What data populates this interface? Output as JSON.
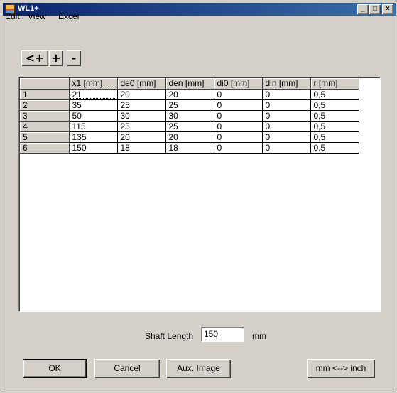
{
  "window": {
    "title": "WL1+"
  },
  "menu": {
    "edit": "Edit",
    "view": "View",
    "excel": "Excel"
  },
  "toolbar": {
    "insert_before": "<+",
    "add": "+",
    "remove": "-"
  },
  "table": {
    "columns": [
      "",
      "x1 [mm]",
      "de0 [mm]",
      "den [mm]",
      "di0 [mm]",
      "din [mm]",
      "r [mm]"
    ],
    "rows": [
      [
        "1",
        "21",
        "20",
        "20",
        "0",
        "0",
        "0,5"
      ],
      [
        "2",
        "35",
        "25",
        "25",
        "0",
        "0",
        "0,5"
      ],
      [
        "3",
        "50",
        "30",
        "30",
        "0",
        "0",
        "0,5"
      ],
      [
        "4",
        "115",
        "25",
        "25",
        "0",
        "0",
        "0,5"
      ],
      [
        "5",
        "135",
        "20",
        "20",
        "0",
        "0",
        "0,5"
      ],
      [
        "6",
        "150",
        "18",
        "18",
        "0",
        "0",
        "0,5"
      ]
    ]
  },
  "shaft": {
    "label": "Shaft Length",
    "value": "150",
    "unit": "mm"
  },
  "buttons": {
    "ok": "OK",
    "cancel": "Cancel",
    "aux_image": "Aux. Image",
    "convert": "mm <--> inch"
  }
}
